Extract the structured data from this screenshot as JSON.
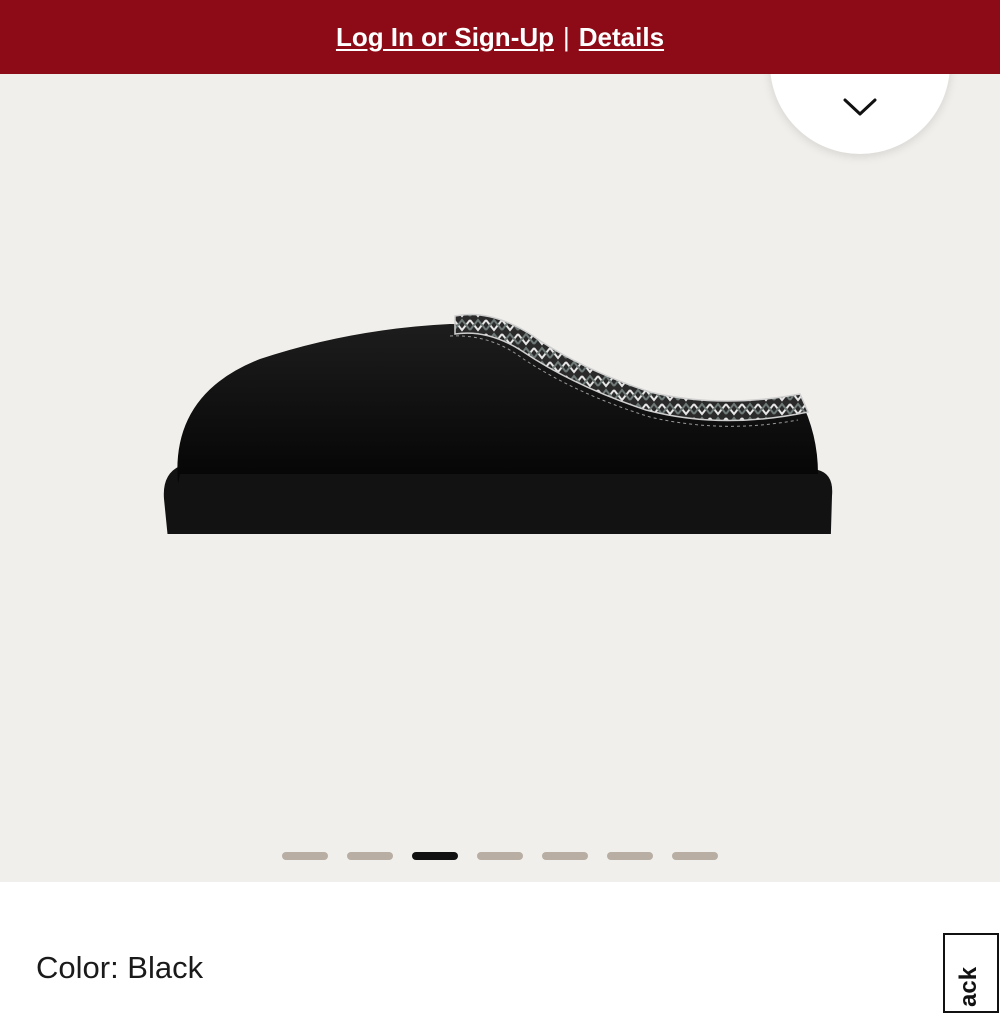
{
  "banner": {
    "login_link": "Log In or Sign-Up",
    "separator": "|",
    "details_link": "Details",
    "background": "#8c0b16"
  },
  "gallery": {
    "collapse_icon": "chevron-down-icon",
    "image_alt": "Black slipper with braided trim",
    "slide_count": 7,
    "active_index": 2
  },
  "product": {
    "color_label": "Color: Black"
  },
  "feedback_tab": {
    "label": "ack"
  }
}
